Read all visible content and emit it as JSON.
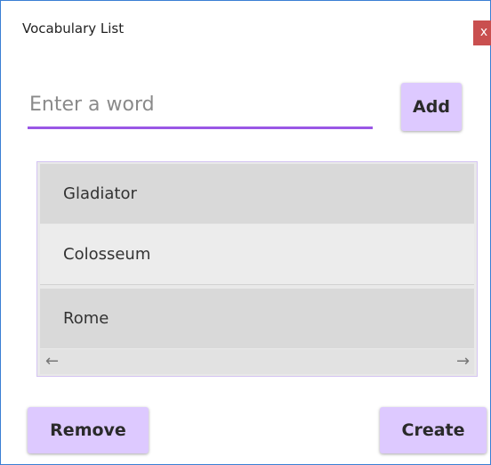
{
  "window": {
    "title": "Vocabulary List",
    "close_glyph": "x"
  },
  "entry": {
    "placeholder": "Enter a word",
    "value": ""
  },
  "buttons": {
    "add": "Add",
    "remove": "Remove",
    "create": "Create"
  },
  "list": {
    "items": [
      "Gladiator",
      "Colosseum",
      "Rome"
    ],
    "scroll_left_icon": "←",
    "scroll_right_icon": "→"
  },
  "colors": {
    "accent": "#9a57e6",
    "button_bg": "#ddc9ff",
    "close_bg": "#c94f4f",
    "window_border": "#3b7fd4"
  }
}
